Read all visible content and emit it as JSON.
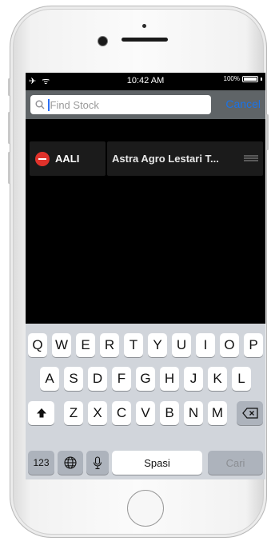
{
  "status_bar": {
    "left_icons": "✈ ᯤ",
    "time": "10:42 AM",
    "battery_label": "100%",
    "battery_level": 1.0
  },
  "search": {
    "placeholder": "Find Stock",
    "value": "",
    "cancel_label": "Cancel"
  },
  "watchlist": [
    {
      "code": "AALI",
      "name": "Astra Agro Lestari T..."
    }
  ],
  "keyboard": {
    "row1": [
      "Q",
      "W",
      "E",
      "R",
      "T",
      "Y",
      "U",
      "I",
      "O",
      "P"
    ],
    "row2": [
      "A",
      "S",
      "D",
      "F",
      "G",
      "H",
      "J",
      "K",
      "L"
    ],
    "row3": [
      "Z",
      "X",
      "C",
      "V",
      "B",
      "N",
      "M"
    ],
    "numbers_label": "123",
    "space_label": "Spasi",
    "search_label": "Cari"
  },
  "colors": {
    "delete": "#e0322b",
    "accent": "#1a73e8",
    "keyboard_bg": "#d1d5db"
  }
}
